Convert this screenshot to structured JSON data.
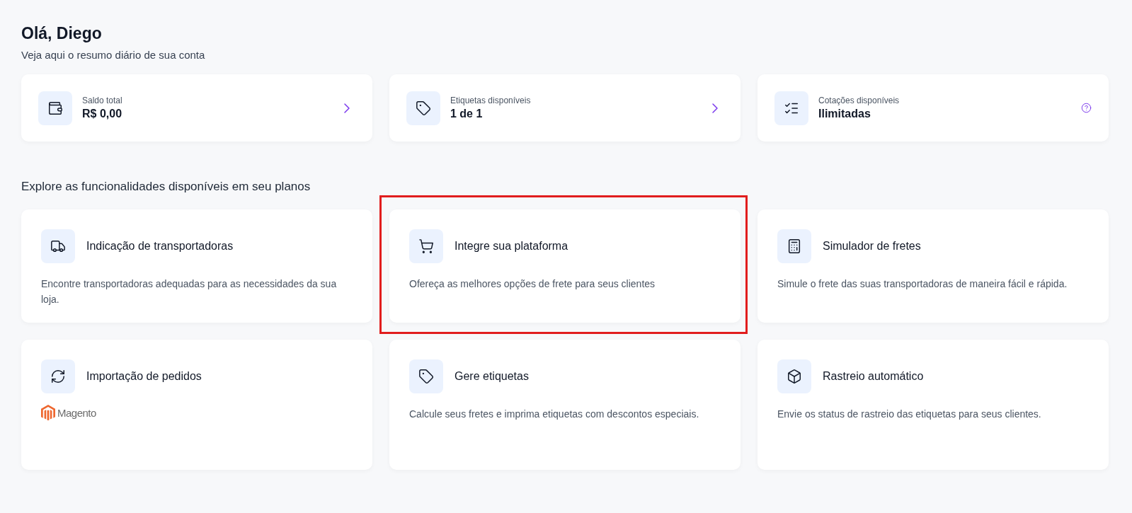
{
  "greeting": {
    "title": "Olá, Diego",
    "subtitle": "Veja aqui o resumo diário de sua conta"
  },
  "stats": [
    {
      "label": "Saldo total",
      "value": "R$ 0,00"
    },
    {
      "label": "Etiquetas disponíveis",
      "value": "1 de 1"
    },
    {
      "label": "Cotações disponíveis",
      "value": "Ilimitadas"
    }
  ],
  "features_title": "Explore as funcionalidades disponíveis em seu planos",
  "features": [
    {
      "title": "Indicação de transportadoras",
      "description": "Encontre transportadoras adequadas para as necessidades da sua loja.",
      "highlighted": false
    },
    {
      "title": "Integre sua plataforma",
      "description": "Ofereça as melhores opções de frete para seus clientes",
      "highlighted": true
    },
    {
      "title": "Simulador de fretes",
      "description": "Simule o frete das suas transportadoras de maneira fácil e rápida.",
      "highlighted": false
    },
    {
      "title": "Importação de pedidos",
      "logo": "Magento",
      "highlighted": false
    },
    {
      "title": "Gere etiquetas",
      "description": "Calcule seus fretes e imprima etiquetas com descontos especiais.",
      "highlighted": false
    },
    {
      "title": "Rastreio automático",
      "description": "Envie os status de rastreio das etiquetas para seus clientes.",
      "highlighted": false
    }
  ]
}
